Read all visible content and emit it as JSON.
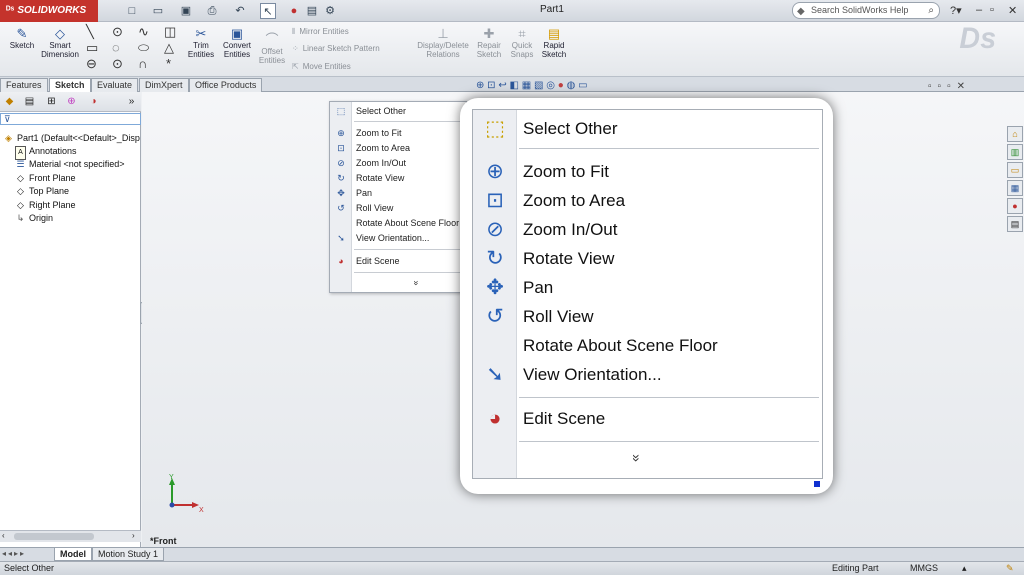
{
  "app": {
    "logo_text": "SOLIDWORKS",
    "document_title": "Part1",
    "search_placeholder": "Search SolidWorks Help"
  },
  "ribbon": {
    "sketch": "Sketch",
    "smart_dimension": "Smart Dimension",
    "trim_entities": "Trim Entities",
    "convert_entities": "Convert Entities",
    "offset_entities": "Offset Entities",
    "mirror_entities": "Mirror Entities",
    "linear_sketch_pattern": "Linear Sketch Pattern",
    "move_entities": "Move Entities",
    "display_delete_relations": "Display/Delete Relations",
    "repair_sketch": "Repair Sketch",
    "quick_snaps": "Quick Snaps",
    "rapid_sketch": "Rapid Sketch"
  },
  "command_tabs": [
    "Features",
    "Sketch",
    "Evaluate",
    "DimXpert",
    "Office Products"
  ],
  "feature_tree": {
    "root": "Part1  (Default<<Default>_Disp",
    "items": [
      "Annotations",
      "Material <not specified>",
      "Front Plane",
      "Top Plane",
      "Right Plane",
      "Origin"
    ]
  },
  "context_menu": {
    "items": [
      {
        "label": "Select Other",
        "icon": "select-other-icon"
      },
      {
        "label": "Zoom to Fit",
        "icon": "zoom-to-fit-icon"
      },
      {
        "label": "Zoom to Area",
        "icon": "zoom-to-area-icon"
      },
      {
        "label": "Zoom In/Out",
        "icon": "zoom-in-out-icon"
      },
      {
        "label": "Rotate View",
        "icon": "rotate-view-icon"
      },
      {
        "label": "Pan",
        "icon": "pan-icon"
      },
      {
        "label": "Roll View",
        "icon": "roll-view-icon"
      },
      {
        "label": "Rotate About Scene Floor",
        "icon": ""
      },
      {
        "label": "View Orientation...",
        "icon": "view-orientation-icon"
      },
      {
        "label": "Edit Scene",
        "icon": "edit-scene-icon"
      }
    ],
    "more_glyph": "»"
  },
  "viewport": {
    "view_name": "*Front",
    "triad_x": "X",
    "triad_y": "Y"
  },
  "bottom_tabs": [
    "Model",
    "Motion Study 1"
  ],
  "status_bar": {
    "text": "Select Other",
    "mode": "Editing Part",
    "units": "MMGS"
  },
  "colors": {
    "brand": "#c4332c",
    "accent_blue": "#2a62b8"
  }
}
